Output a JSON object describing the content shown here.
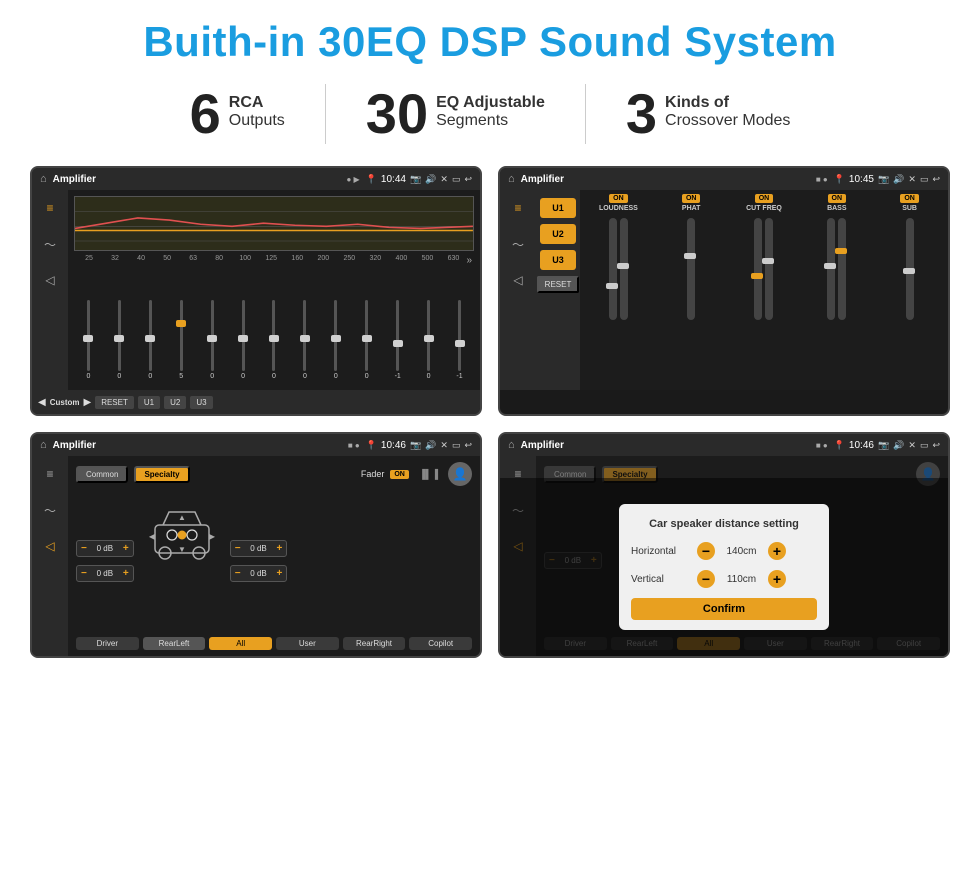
{
  "page": {
    "title": "Buith-in 30EQ DSP Sound System",
    "stats": [
      {
        "number": "6",
        "label_main": "RCA",
        "label_sub": "Outputs"
      },
      {
        "number": "30",
        "label_main": "EQ Adjustable",
        "label_sub": "Segments"
      },
      {
        "number": "3",
        "label_main": "Kinds of",
        "label_sub": "Crossover Modes"
      }
    ]
  },
  "screen1": {
    "status_bar": {
      "title": "Amplifier",
      "time": "10:44"
    },
    "freq_labels": [
      "25",
      "32",
      "40",
      "50",
      "63",
      "80",
      "100",
      "125",
      "160",
      "200",
      "250",
      "320",
      "400",
      "500",
      "630"
    ],
    "eq_values": [
      "0",
      "0",
      "0",
      "5",
      "0",
      "0",
      "0",
      "0",
      "0",
      "0",
      "-1",
      "0",
      "-1"
    ],
    "bottom_buttons": [
      "Custom",
      "RESET",
      "U1",
      "U2",
      "U3"
    ]
  },
  "screen2": {
    "status_bar": {
      "title": "Amplifier",
      "time": "10:45"
    },
    "u_buttons": [
      "U1",
      "U2",
      "U3"
    ],
    "channels": [
      "LOUDNESS",
      "PHAT",
      "CUT FREQ",
      "BASS",
      "SUB"
    ],
    "reset_label": "RESET"
  },
  "screen3": {
    "status_bar": {
      "title": "Amplifier",
      "time": "10:46"
    },
    "tabs": [
      "Common",
      "Specialty"
    ],
    "fader_label": "Fader",
    "fader_on": "ON",
    "db_values": [
      "0 dB",
      "0 dB",
      "0 dB",
      "0 dB"
    ],
    "nav_buttons": [
      "Driver",
      "RearLeft",
      "All",
      "User",
      "RearRight",
      "Copilot"
    ]
  },
  "screen4": {
    "status_bar": {
      "title": "Amplifier",
      "time": "10:46"
    },
    "tabs": [
      "Common",
      "Specialty"
    ],
    "modal": {
      "title": "Car speaker distance setting",
      "horizontal_label": "Horizontal",
      "horizontal_value": "140cm",
      "vertical_label": "Vertical",
      "vertical_value": "110cm",
      "confirm_label": "Confirm"
    },
    "nav_buttons": [
      "Driver",
      "RearLeft",
      "All",
      "User",
      "RearRight",
      "Copilot"
    ],
    "db_values": [
      "0 dB",
      "0 dB"
    ]
  }
}
